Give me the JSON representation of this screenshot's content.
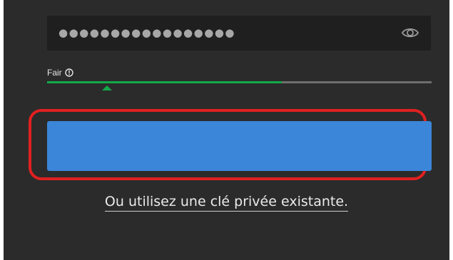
{
  "password": {
    "masked_value": "●●●●●●●●●●●●●●●●●",
    "toggle_icon": "eye-icon"
  },
  "strength": {
    "label": "Fair",
    "info_icon": "info-icon",
    "level_fraction": 0.61,
    "marker_fraction": 0.155,
    "fill_color": "#14a84a",
    "track_color": "#6e6e6e"
  },
  "submit_button": {
    "label": "",
    "color": "#3b86d9"
  },
  "highlight_color": "#e02020",
  "alternate_link": {
    "text": "Ou utilisez une clé privée existante."
  }
}
